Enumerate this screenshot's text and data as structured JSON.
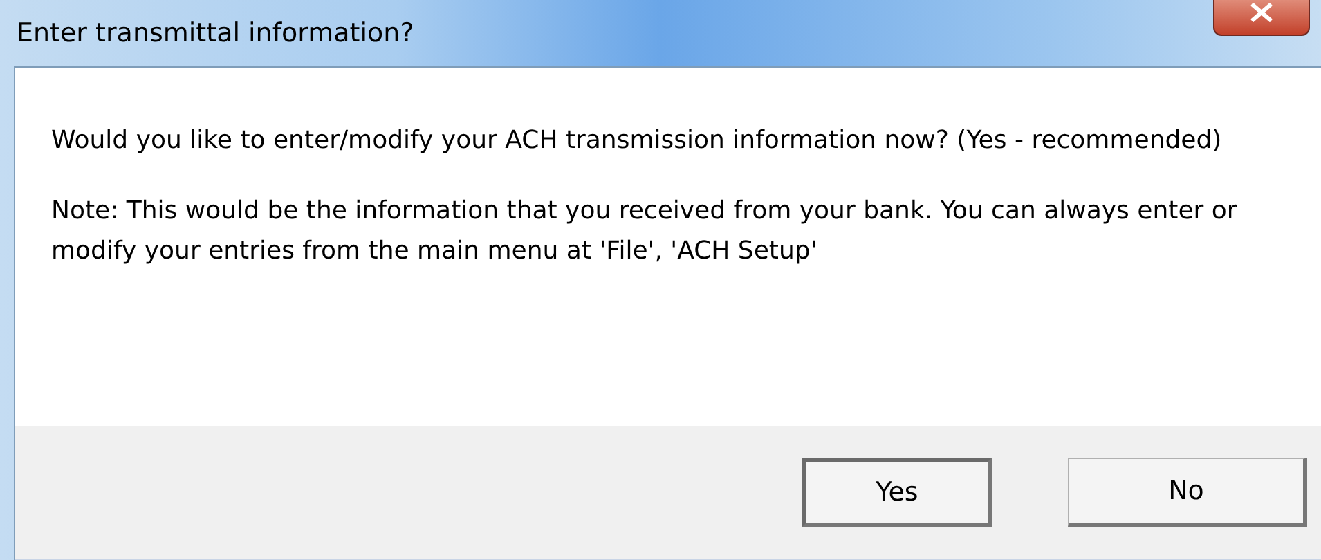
{
  "window": {
    "title": "Enter transmittal information?"
  },
  "message": [
    "Would you like to enter/modify your ACH transmission information now? (Yes - recommended)",
    "Note: This would be the information that you received from your bank.  You can always enter or modify your entries from the main menu at 'File', 'ACH Setup'"
  ],
  "buttons": [
    {
      "label": "Yes",
      "default": true
    },
    {
      "label": "No",
      "default": false
    }
  ]
}
